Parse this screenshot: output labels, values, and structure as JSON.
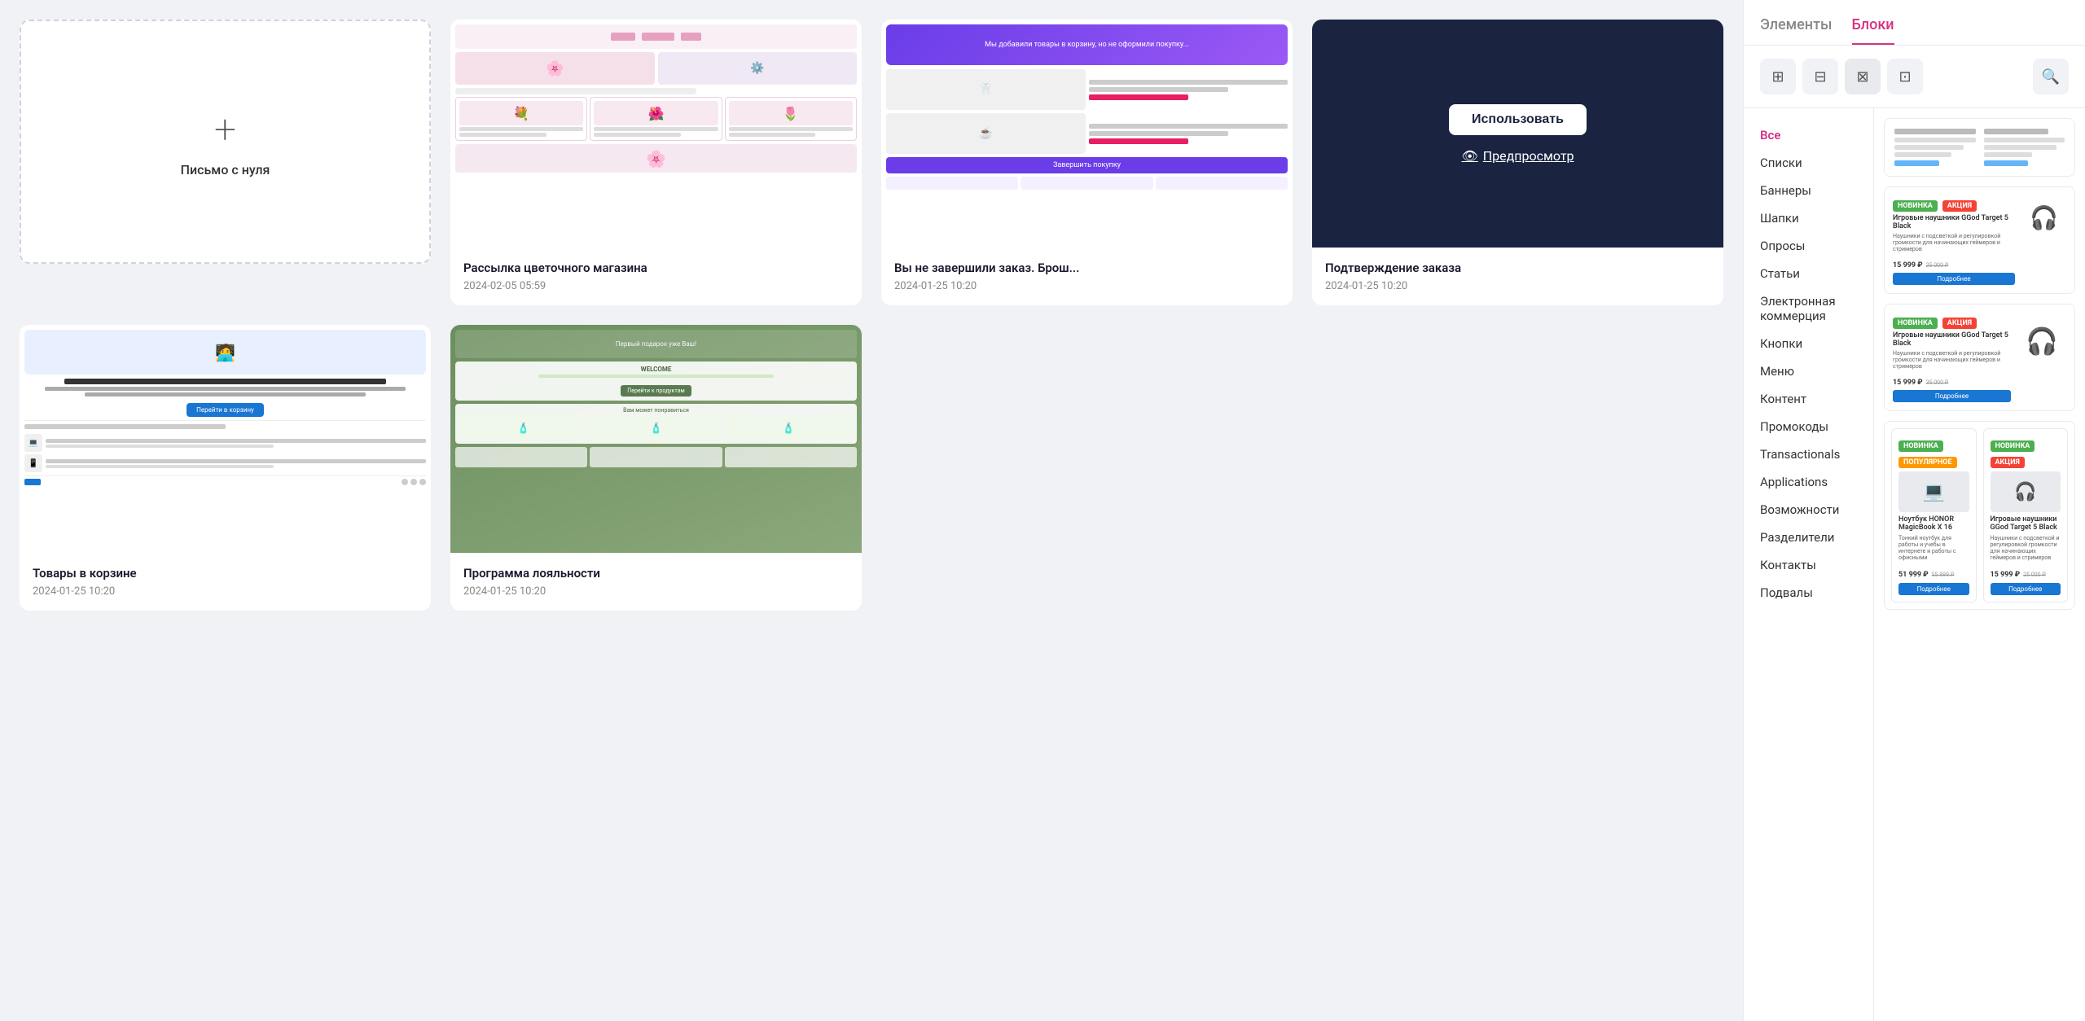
{
  "mainArea": {
    "newCard": {
      "label": "Письмо с нуля"
    },
    "templates": [
      {
        "id": "flower",
        "title": "Рассылка цветочного магазина",
        "date": "2024-02-05 05:59",
        "type": "flower"
      },
      {
        "id": "abandon",
        "title": "Вы не завершили заказ. Брош...",
        "date": "2024-01-25 10:20",
        "type": "abandon"
      },
      {
        "id": "confirm",
        "title": "Подтверждение заказа",
        "date": "2024-01-25 10:20",
        "type": "confirm",
        "useLabel": "Использовать",
        "previewLabel": "Предпросмотр"
      },
      {
        "id": "cart",
        "title": "Товары в корзине",
        "date": "2024-01-25 10:20",
        "type": "cart"
      },
      {
        "id": "loyalty",
        "title": "Программа лояльности",
        "date": "2024-01-25 10:20",
        "type": "loyalty"
      }
    ]
  },
  "rightPanel": {
    "tabs": [
      {
        "id": "elements",
        "label": "Элементы"
      },
      {
        "id": "blocks",
        "label": "Блоки"
      }
    ],
    "activeTab": "blocks",
    "categories": [
      {
        "id": "all",
        "label": "Все",
        "active": true
      },
      {
        "id": "lists",
        "label": "Списки"
      },
      {
        "id": "banners",
        "label": "Баннеры"
      },
      {
        "id": "headers",
        "label": "Шапки"
      },
      {
        "id": "surveys",
        "label": "Опросы"
      },
      {
        "id": "articles",
        "label": "Статьи"
      },
      {
        "id": "ecommerce",
        "label": "Электронная коммерция"
      },
      {
        "id": "buttons",
        "label": "Кнопки"
      },
      {
        "id": "menu",
        "label": "Меню"
      },
      {
        "id": "content",
        "label": "Контент"
      },
      {
        "id": "promocodes",
        "label": "Промокоды"
      },
      {
        "id": "transactionals",
        "label": "Transactionals"
      },
      {
        "id": "applications",
        "label": "Applications"
      },
      {
        "id": "features",
        "label": "Возможности"
      },
      {
        "id": "dividers",
        "label": "Разделители"
      },
      {
        "id": "contacts",
        "label": "Контакты"
      },
      {
        "id": "footers",
        "label": "Подвалы"
      }
    ],
    "toolbar": {
      "icons": [
        "⊞",
        "⊟",
        "⊠",
        "⊡",
        "🔍"
      ]
    },
    "blocks": [
      {
        "id": "text-block-1",
        "type": "text"
      },
      {
        "id": "product-single",
        "type": "product-single",
        "badge1": "НОВИНКА",
        "badge2": "АКЦИЯ",
        "name": "Игровые наушники GGod Target 5 Black",
        "desc": "Наушники с подсветкой и регулировкой громкости для начинающих геймеров и стримеров",
        "newPrice": "15 999 ₽",
        "oldPrice": "25 000 ₽",
        "btnLabel": "Подробнее"
      },
      {
        "id": "product-single-2",
        "type": "product-single-lg",
        "badge1": "НОВИНКА",
        "badge2": "АКЦИЯ",
        "name": "Игровые наушники GGod Target 5 Black",
        "desc": "Наушники с подсветкой и регулировкой громкости для начинающих геймеров и стримеров",
        "newPrice": "15 999 ₽",
        "oldPrice": "35 000 ₽",
        "btnLabel": "Подробнее"
      },
      {
        "id": "product-pair",
        "type": "product-pair",
        "left": {
          "badge1": "НОВИНКА",
          "badge2": "ПОПУЛЯРНОЕ",
          "name": "Ноутбук HONOR MagicBook X 16",
          "desc": "Тонкий ноутбук для работы и учебы в интернете и работы с офисными",
          "newPrice": "51 999 ₽",
          "oldPrice": "55 999 ₽",
          "btnLabel": "Подробнее"
        },
        "right": {
          "badge1": "НОВИНКА",
          "badge2": "АКЦИЯ",
          "name": "Игровые наушники GGod Target 5 Black",
          "desc": "Наушники с подсветкой и регулировкой громкости для начинающих геймеров и стримеров",
          "newPrice": "15 999 ₽",
          "oldPrice": "25 000 ₽",
          "btnLabel": "Подробнее"
        }
      },
      {
        "id": "product-grid",
        "type": "product-grid"
      }
    ]
  }
}
